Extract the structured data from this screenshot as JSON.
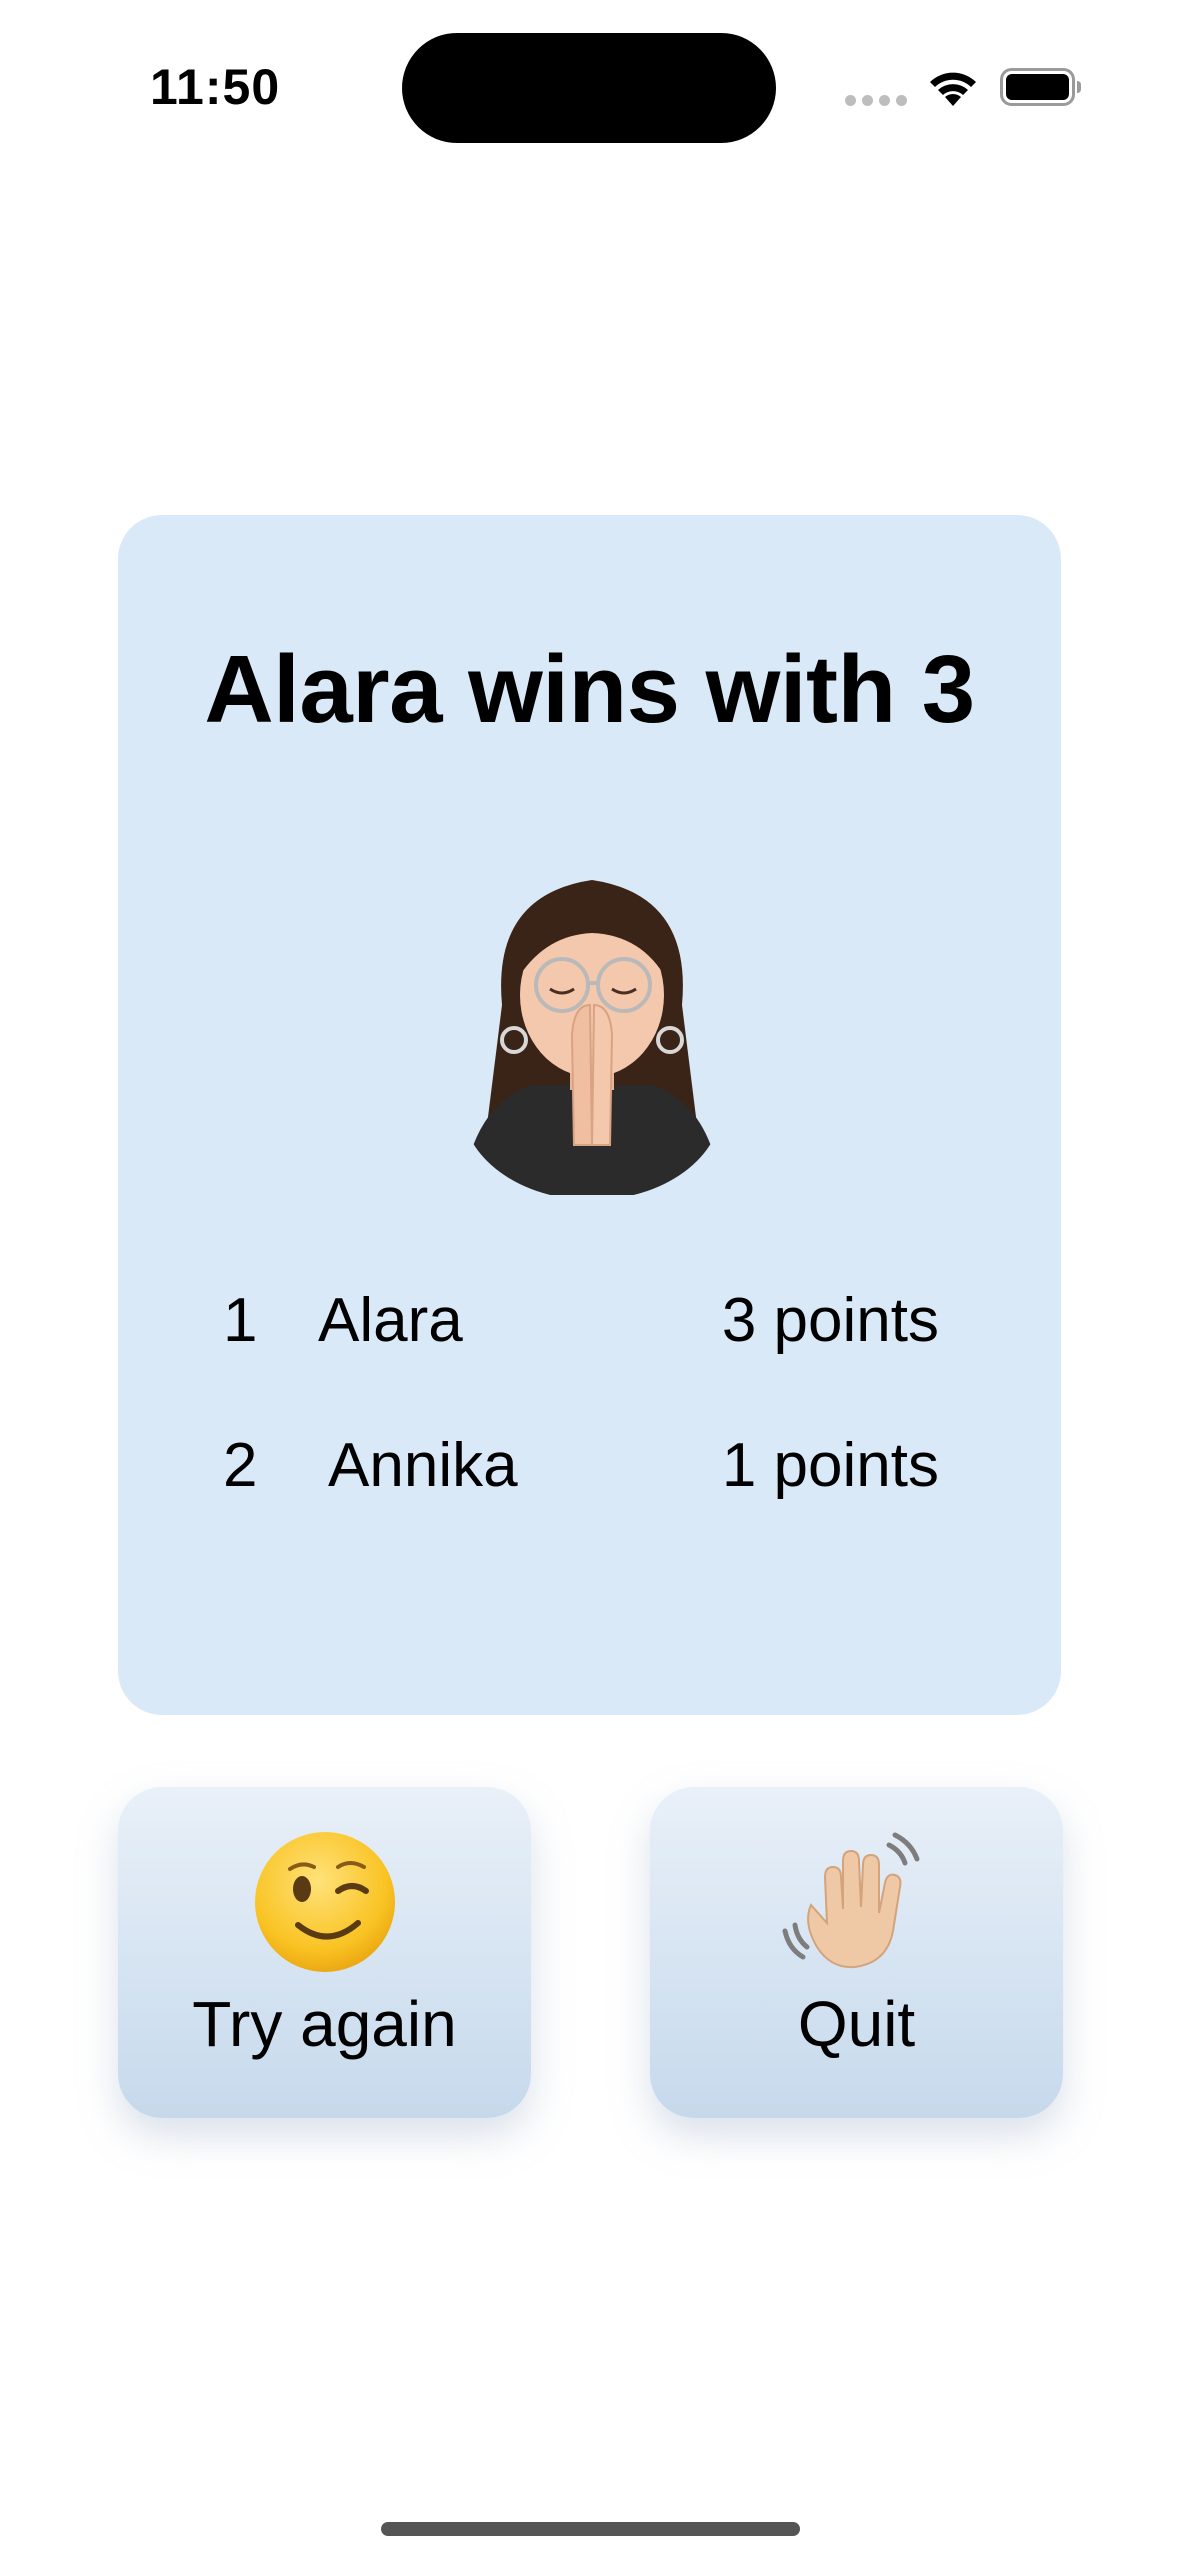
{
  "status_bar": {
    "time": "11:50",
    "icons": [
      "signal-dots-icon",
      "wifi-icon",
      "battery-icon"
    ]
  },
  "result": {
    "title": "Alara wins with 3",
    "avatar_icon": "memoji-praying-hands",
    "scores": [
      {
        "rank": "1",
        "name": "Alara",
        "points": "3 points"
      },
      {
        "rank": "2",
        "name": "Annika",
        "points": "1 points"
      }
    ]
  },
  "buttons": {
    "try_again": {
      "icon": "winking-face-emoji",
      "label": "Try again"
    },
    "quit": {
      "icon": "waving-hand-emoji",
      "label": "Quit"
    }
  },
  "colors": {
    "card_background": "#dae9f7",
    "button_gradient_top": "#e9f0f8",
    "button_gradient_bottom": "#c6d9ec"
  }
}
